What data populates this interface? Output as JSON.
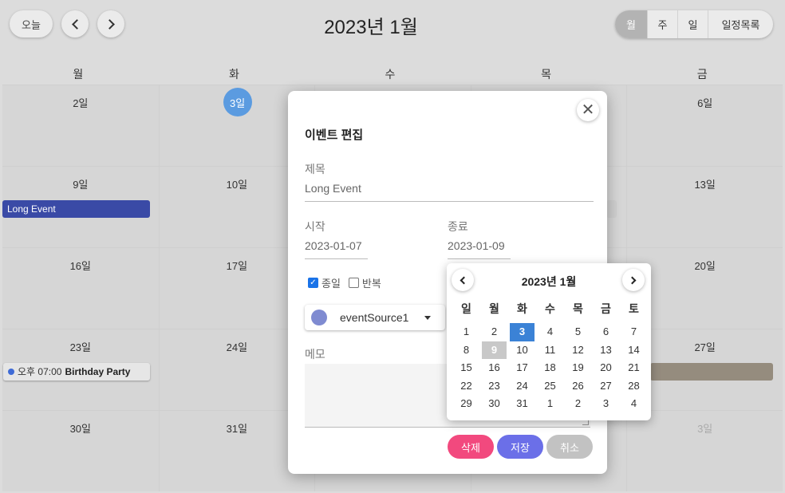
{
  "toolbar": {
    "today_label": "오늘",
    "month_title": "2023년 1월",
    "views": [
      {
        "label": "월",
        "active": true
      },
      {
        "label": "주",
        "active": false
      },
      {
        "label": "일",
        "active": false
      },
      {
        "label": "일정목록",
        "active": false
      }
    ]
  },
  "calendar": {
    "weekdays": [
      "월",
      "화",
      "수",
      "목",
      "금"
    ],
    "weeks": [
      [
        "2일",
        "3일",
        "",
        "",
        "6일"
      ],
      [
        "9일",
        "10일",
        "",
        "",
        "13일"
      ],
      [
        "16일",
        "17일",
        "",
        "",
        "20일"
      ],
      [
        "23일",
        "24일",
        "",
        "",
        "27일"
      ],
      [
        "30일",
        "31일",
        "",
        "",
        "3일"
      ]
    ],
    "events": {
      "long_event": "Long Event",
      "party_time": "오후 07:00",
      "party_title": "Birthday Party"
    },
    "colors": {
      "long_event": "#3a4aa6",
      "party_dot": "#3f6bd6",
      "other_event": "#958c7e",
      "today": "#5b9be0"
    }
  },
  "modal": {
    "title": "이벤트 편집",
    "title_label": "제목",
    "title_value": "Long Event",
    "start_label": "시작",
    "start_value": "2023-01-07",
    "end_label": "종료",
    "end_value": "2023-01-09",
    "allday_label": "종일",
    "allday_checked": true,
    "repeat_label": "반복",
    "repeat_checked": false,
    "source_value": "eventSource1",
    "memo_label": "메모",
    "delete_label": "삭제",
    "save_label": "저장",
    "cancel_label": "취소",
    "close_glyph": "✕"
  },
  "picker": {
    "title": "2023년 1월",
    "weekdays": [
      "일",
      "월",
      "화",
      "수",
      "목",
      "금",
      "토"
    ],
    "days": [
      [
        "1",
        "2",
        "3",
        "4",
        "5",
        "6",
        "7"
      ],
      [
        "8",
        "9",
        "10",
        "11",
        "12",
        "13",
        "14"
      ],
      [
        "15",
        "16",
        "17",
        "18",
        "19",
        "20",
        "21"
      ],
      [
        "22",
        "23",
        "24",
        "25",
        "26",
        "27",
        "28"
      ],
      [
        "29",
        "30",
        "31",
        "1",
        "2",
        "3",
        "4"
      ]
    ],
    "selected": "3",
    "highlight": "9"
  }
}
